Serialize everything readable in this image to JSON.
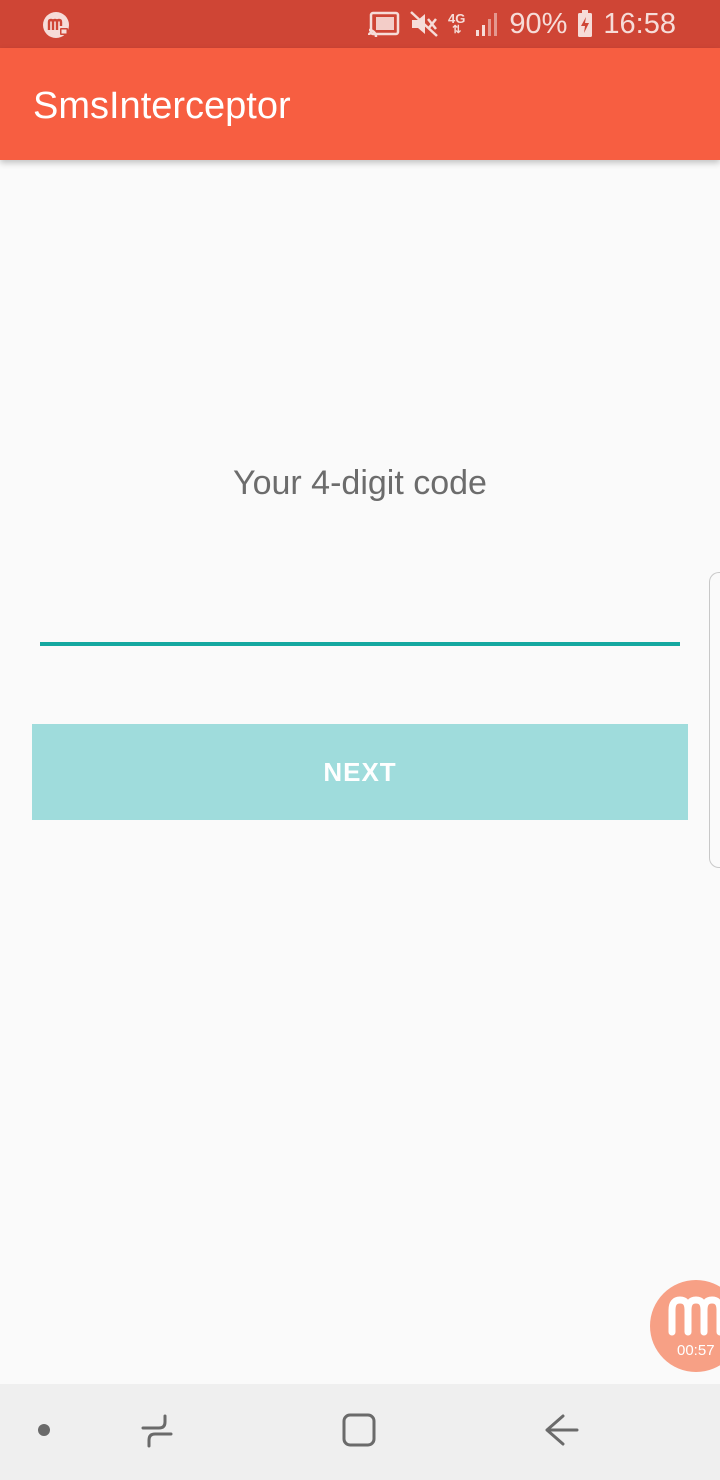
{
  "status_bar": {
    "battery": "90%",
    "network": "4G",
    "time": "16:58",
    "icons": [
      "recorder-icon",
      "cast-icon",
      "mute-icon",
      "network-4g-icon",
      "signal-icon",
      "battery-charging-icon"
    ]
  },
  "app_bar": {
    "title": "SmsInterceptor"
  },
  "main": {
    "prompt": "Your 4-digit code",
    "code_value": "",
    "next_label": "NEXT"
  },
  "recorder": {
    "elapsed": "00:57"
  },
  "nav_bar": {
    "icons": [
      "dot-icon",
      "recents-icon",
      "home-icon",
      "back-icon"
    ]
  },
  "colors": {
    "status_bar": "#cf4535",
    "app_bar": "#f75e41",
    "accent": "#14a8a0",
    "button": "#9fdcdc",
    "background": "#fafafa"
  }
}
